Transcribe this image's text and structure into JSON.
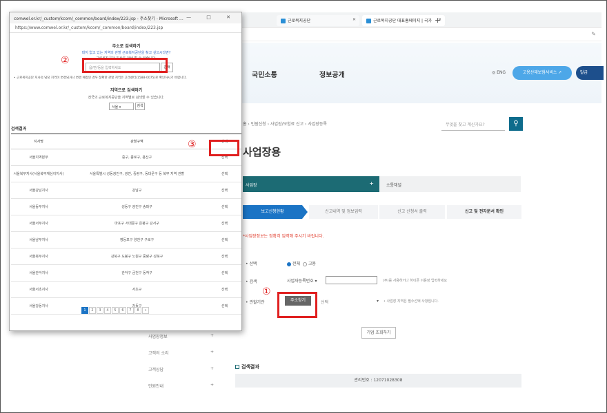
{
  "browser": {
    "tabs": [
      {
        "label": "근로복지공단"
      },
      {
        "label": "근로복지공단 대표홈페이지 | 국가"
      }
    ],
    "new_tab": "+",
    "pencil": "✎"
  },
  "site": {
    "nav": [
      "국민소통",
      "정보공개"
    ],
    "eng": "◎ ENG",
    "service_button": "고용산재보험서비스 ↗",
    "right_button": "발급",
    "breadcrumb": "홈 › 민원신청 › 사업장/보험료 신고 › 사업장등록",
    "search_placeholder": "무엇을 찾고 계신가요?",
    "page_title": "사업장용",
    "tab_active": "사업장",
    "tab_other": "소통채널",
    "steps": [
      "보고신청현황",
      "신고내역 및 정보입력",
      "신고 신청서 출력",
      "신고 및 전자문서 확인"
    ],
    "notice": "*사업장정보는 정확히 입력해 주시기 바랍니다.",
    "form": {
      "label_select": "• 선택",
      "label_input": "• 검색",
      "label_addr": "• 관할기관",
      "radio_on": "전체",
      "radio_off": "고용",
      "select_value": "사업자등록번호 ▾",
      "helper": "(주)를 사용하거나 하이픈 이용장 입력하세요",
      "addr_button": "주소찾기",
      "addr_dropdown": "선택",
      "addr_arrow": "▾",
      "addr_helper": "• 사업장 지역은 필수선택 사항입니다.",
      "search_button": "기업 조회하기"
    },
    "result_section": "검색결과",
    "result_bar": "관리번호 : 12071028308",
    "left_menu": [
      "사업장정보",
      "고객의 소리",
      "고객상담",
      "민원안내"
    ]
  },
  "popup": {
    "window_title": "comwel.or.kr/_custom/kcom/_common/board/index/223.jsp - 주소찾기 - Microsoft ...",
    "window_controls": "— □ ✕",
    "url": "https://www.comwel.or.kr/_custom/kcom/_common/board/index/223.jsp",
    "section1_title": "주소로 검색하기",
    "section1_hint": "대지 없고 있는 지역의 관할 근로복지공단을 찾고 싶으시다면?",
    "section1_hint2": "근로복지공단 지사를 검색 할 수 있습니다.",
    "search_placeholder": "읍/면/동을 입력하세요",
    "search_button": "검색",
    "note": "• 근로복지공단 지사의 담당 지역이 변경되거나 변경 예정인 경우 정확한 관할 지역은 고객센터(1588-0075)로 확인하시기 바랍니다.",
    "section2_title": "지역으로 검색하기",
    "section2_hint": "전국의 근로복지공단을 지역별로 검색할 수 있습니다.",
    "region_select": "서울 ▾",
    "region_button": "검색",
    "result_label": "검색결과",
    "table_headers": [
      "지사명",
      "관할구역",
      "선택"
    ],
    "rows": [
      {
        "name": "서울지역본부",
        "area": "중구, 종로구, 용산구",
        "select": "선택"
      },
      {
        "name": "서울북부지사(서울북부재심이지사)",
        "area": "서울특별시 성동광진구, 광진, 중랑구, 동대문구 등 북부 지역 관할",
        "select": "선택"
      },
      {
        "name": "서울강남지사",
        "area": "강남구",
        "select": "선택"
      },
      {
        "name": "서울동부지사",
        "area": "성동구 광진구 송파구",
        "select": "선택"
      },
      {
        "name": "서울서부지사",
        "area": "마포구 서대문구 은평구 강서구",
        "select": "선택"
      },
      {
        "name": "서울남부지사",
        "area": "영등포구 양천구 구로구",
        "select": "선택"
      },
      {
        "name": "서울북부지사",
        "area": "강북구 도봉구 노원구 중랑구 성북구",
        "select": "선택"
      },
      {
        "name": "서울관악지사",
        "area": "관악구 금천구 동작구",
        "select": "선택"
      },
      {
        "name": "서울서초지사",
        "area": "서초구",
        "select": "선택"
      },
      {
        "name": "서울강동지사",
        "area": "강동구",
        "select": "선택"
      }
    ],
    "pages": [
      "1",
      "2",
      "3",
      "4",
      "5",
      "6",
      "7",
      "8",
      "»"
    ]
  },
  "annotations": {
    "mark1": "①",
    "mark2": "②",
    "mark3": "③",
    "highlight_color": "#e02020"
  }
}
